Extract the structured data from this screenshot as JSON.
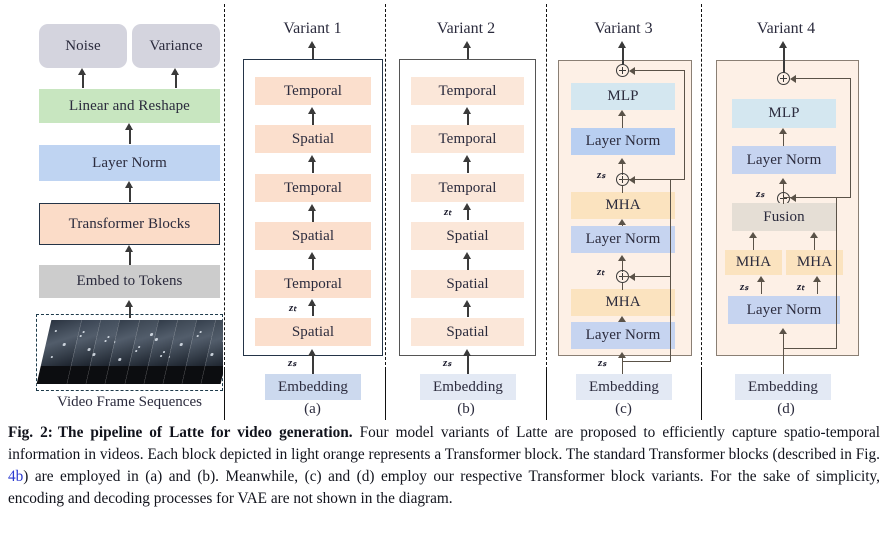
{
  "figure": {
    "number": "Fig. 2:",
    "title_bold": "The pipeline of Latte for video generation.",
    "body": " Four model variants of Latte are proposed to efficiently capture spatio-temporal information in videos. Each block depicted in light orange represents a Transformer block. The standard Transformer blocks (described in Fig. ",
    "ref": "4b",
    "body2": ") are employed in (a) and (b). Meanwhile, (c) and (d) employ our respective Transformer block variants. For the sake of simplicity, encoding and decoding processes for VAE are not shown in the diagram."
  },
  "pipeline": {
    "outputs": [
      {
        "label": "Noise",
        "color": "#d4d4de"
      },
      {
        "label": "Variance",
        "color": "#d4d4de"
      }
    ],
    "stack": [
      {
        "label": "Linear and Reshape",
        "color": "#c8e6c0"
      },
      {
        "label": "Layer Norm",
        "color": "#bfd4f2"
      },
      {
        "label": "Transformer Blocks",
        "color": "#fbdcc8"
      },
      {
        "label": "Embed to Tokens",
        "color": "#cccccc"
      }
    ],
    "video_caption": "Video Frame Sequences",
    "frame_count": 9
  },
  "variants": [
    {
      "title": "Variant 1",
      "sublabel": "(a)",
      "embedding": "Embedding",
      "input_label": "z_s",
      "blocks": [
        {
          "label": "Temporal",
          "color": "#fbdfcd"
        },
        {
          "label": "Spatial",
          "color": "#fbdfcd"
        },
        {
          "label": "Temporal",
          "color": "#fbdfcd"
        },
        {
          "label": "Spatial",
          "color": "#fbdfcd"
        },
        {
          "label": "Temporal",
          "color": "#fbdfcd"
        },
        {
          "label": "Spatial",
          "color": "#fbdfcd"
        }
      ],
      "mid_label": "z_t",
      "mid_label_index": 4
    },
    {
      "title": "Variant 2",
      "sublabel": "(b)",
      "embedding": "Embedding",
      "input_label": "z_s",
      "blocks": [
        {
          "label": "Temporal",
          "color": "#fbe7d9"
        },
        {
          "label": "Temporal",
          "color": "#fbe7d9"
        },
        {
          "label": "Temporal",
          "color": "#fbe7d9"
        },
        {
          "label": "Spatial",
          "color": "#fbe7d9"
        },
        {
          "label": "Spatial",
          "color": "#fbe7d9"
        },
        {
          "label": "Spatial",
          "color": "#fbe7d9"
        }
      ],
      "mid_label": "z_t",
      "mid_label_index": 2
    },
    {
      "title": "Variant 3",
      "sublabel": "(c)",
      "embedding": "Embedding",
      "input_label": "z_s",
      "blocks": [
        {
          "label": "MLP",
          "color": "#d4e7f0"
        },
        {
          "label": "Layer Norm",
          "color": "#b9cff1"
        },
        {
          "label": "MHA",
          "color": "#fbe3bf"
        },
        {
          "label": "Layer Norm",
          "color": "#c6d4f0"
        },
        {
          "label": "MHA",
          "color": "#fbe3bf"
        },
        {
          "label": "Layer Norm",
          "color": "#c6d4f0"
        }
      ],
      "residual_labels": {
        "upper": "z_s",
        "lower": "z_t"
      }
    },
    {
      "title": "Variant 4",
      "sublabel": "(d)",
      "embedding": "Embedding",
      "blocks": [
        {
          "label": "MLP",
          "color": "#d4e7f0"
        },
        {
          "label": "Layer Norm",
          "color": "#c6d4f0"
        },
        {
          "label": "Fusion",
          "color": "#e5ded5"
        },
        {
          "label": "MHA",
          "color": "#fbe3bf"
        },
        {
          "label": "MHA",
          "color": "#fbe3bf"
        },
        {
          "label": "Layer Norm",
          "color": "#c6d4f0"
        }
      ],
      "residual_label": "z_s",
      "branch_labels": {
        "left": "z_s",
        "right": "z_t"
      }
    }
  ],
  "colors": {
    "orange_block": "#fbdcc8",
    "blue_block": "#bfd4f2",
    "green_block": "#c8e6c0",
    "gray_block": "#cccccc",
    "mha": "#fbe3bf",
    "mlp": "#d4e7f0",
    "fusion": "#e5ded5",
    "panel_warm": "#fdf0e6",
    "embedding": "#ccd9ee",
    "link": "#2b3ad0"
  }
}
